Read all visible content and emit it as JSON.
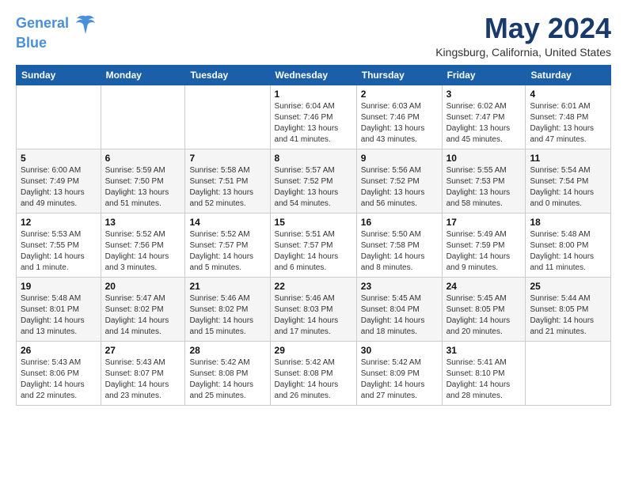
{
  "header": {
    "logo_line1": "General",
    "logo_line2": "Blue",
    "month_title": "May 2024",
    "location": "Kingsburg, California, United States"
  },
  "weekdays": [
    "Sunday",
    "Monday",
    "Tuesday",
    "Wednesday",
    "Thursday",
    "Friday",
    "Saturday"
  ],
  "weeks": [
    [
      {
        "day": "",
        "info": ""
      },
      {
        "day": "",
        "info": ""
      },
      {
        "day": "",
        "info": ""
      },
      {
        "day": "1",
        "info": "Sunrise: 6:04 AM\nSunset: 7:46 PM\nDaylight: 13 hours\nand 41 minutes."
      },
      {
        "day": "2",
        "info": "Sunrise: 6:03 AM\nSunset: 7:46 PM\nDaylight: 13 hours\nand 43 minutes."
      },
      {
        "day": "3",
        "info": "Sunrise: 6:02 AM\nSunset: 7:47 PM\nDaylight: 13 hours\nand 45 minutes."
      },
      {
        "day": "4",
        "info": "Sunrise: 6:01 AM\nSunset: 7:48 PM\nDaylight: 13 hours\nand 47 minutes."
      }
    ],
    [
      {
        "day": "5",
        "info": "Sunrise: 6:00 AM\nSunset: 7:49 PM\nDaylight: 13 hours\nand 49 minutes."
      },
      {
        "day": "6",
        "info": "Sunrise: 5:59 AM\nSunset: 7:50 PM\nDaylight: 13 hours\nand 51 minutes."
      },
      {
        "day": "7",
        "info": "Sunrise: 5:58 AM\nSunset: 7:51 PM\nDaylight: 13 hours\nand 52 minutes."
      },
      {
        "day": "8",
        "info": "Sunrise: 5:57 AM\nSunset: 7:52 PM\nDaylight: 13 hours\nand 54 minutes."
      },
      {
        "day": "9",
        "info": "Sunrise: 5:56 AM\nSunset: 7:52 PM\nDaylight: 13 hours\nand 56 minutes."
      },
      {
        "day": "10",
        "info": "Sunrise: 5:55 AM\nSunset: 7:53 PM\nDaylight: 13 hours\nand 58 minutes."
      },
      {
        "day": "11",
        "info": "Sunrise: 5:54 AM\nSunset: 7:54 PM\nDaylight: 14 hours\nand 0 minutes."
      }
    ],
    [
      {
        "day": "12",
        "info": "Sunrise: 5:53 AM\nSunset: 7:55 PM\nDaylight: 14 hours\nand 1 minute."
      },
      {
        "day": "13",
        "info": "Sunrise: 5:52 AM\nSunset: 7:56 PM\nDaylight: 14 hours\nand 3 minutes."
      },
      {
        "day": "14",
        "info": "Sunrise: 5:52 AM\nSunset: 7:57 PM\nDaylight: 14 hours\nand 5 minutes."
      },
      {
        "day": "15",
        "info": "Sunrise: 5:51 AM\nSunset: 7:57 PM\nDaylight: 14 hours\nand 6 minutes."
      },
      {
        "day": "16",
        "info": "Sunrise: 5:50 AM\nSunset: 7:58 PM\nDaylight: 14 hours\nand 8 minutes."
      },
      {
        "day": "17",
        "info": "Sunrise: 5:49 AM\nSunset: 7:59 PM\nDaylight: 14 hours\nand 9 minutes."
      },
      {
        "day": "18",
        "info": "Sunrise: 5:48 AM\nSunset: 8:00 PM\nDaylight: 14 hours\nand 11 minutes."
      }
    ],
    [
      {
        "day": "19",
        "info": "Sunrise: 5:48 AM\nSunset: 8:01 PM\nDaylight: 14 hours\nand 13 minutes."
      },
      {
        "day": "20",
        "info": "Sunrise: 5:47 AM\nSunset: 8:02 PM\nDaylight: 14 hours\nand 14 minutes."
      },
      {
        "day": "21",
        "info": "Sunrise: 5:46 AM\nSunset: 8:02 PM\nDaylight: 14 hours\nand 15 minutes."
      },
      {
        "day": "22",
        "info": "Sunrise: 5:46 AM\nSunset: 8:03 PM\nDaylight: 14 hours\nand 17 minutes."
      },
      {
        "day": "23",
        "info": "Sunrise: 5:45 AM\nSunset: 8:04 PM\nDaylight: 14 hours\nand 18 minutes."
      },
      {
        "day": "24",
        "info": "Sunrise: 5:45 AM\nSunset: 8:05 PM\nDaylight: 14 hours\nand 20 minutes."
      },
      {
        "day": "25",
        "info": "Sunrise: 5:44 AM\nSunset: 8:05 PM\nDaylight: 14 hours\nand 21 minutes."
      }
    ],
    [
      {
        "day": "26",
        "info": "Sunrise: 5:43 AM\nSunset: 8:06 PM\nDaylight: 14 hours\nand 22 minutes."
      },
      {
        "day": "27",
        "info": "Sunrise: 5:43 AM\nSunset: 8:07 PM\nDaylight: 14 hours\nand 23 minutes."
      },
      {
        "day": "28",
        "info": "Sunrise: 5:42 AM\nSunset: 8:08 PM\nDaylight: 14 hours\nand 25 minutes."
      },
      {
        "day": "29",
        "info": "Sunrise: 5:42 AM\nSunset: 8:08 PM\nDaylight: 14 hours\nand 26 minutes."
      },
      {
        "day": "30",
        "info": "Sunrise: 5:42 AM\nSunset: 8:09 PM\nDaylight: 14 hours\nand 27 minutes."
      },
      {
        "day": "31",
        "info": "Sunrise: 5:41 AM\nSunset: 8:10 PM\nDaylight: 14 hours\nand 28 minutes."
      },
      {
        "day": "",
        "info": ""
      }
    ]
  ]
}
